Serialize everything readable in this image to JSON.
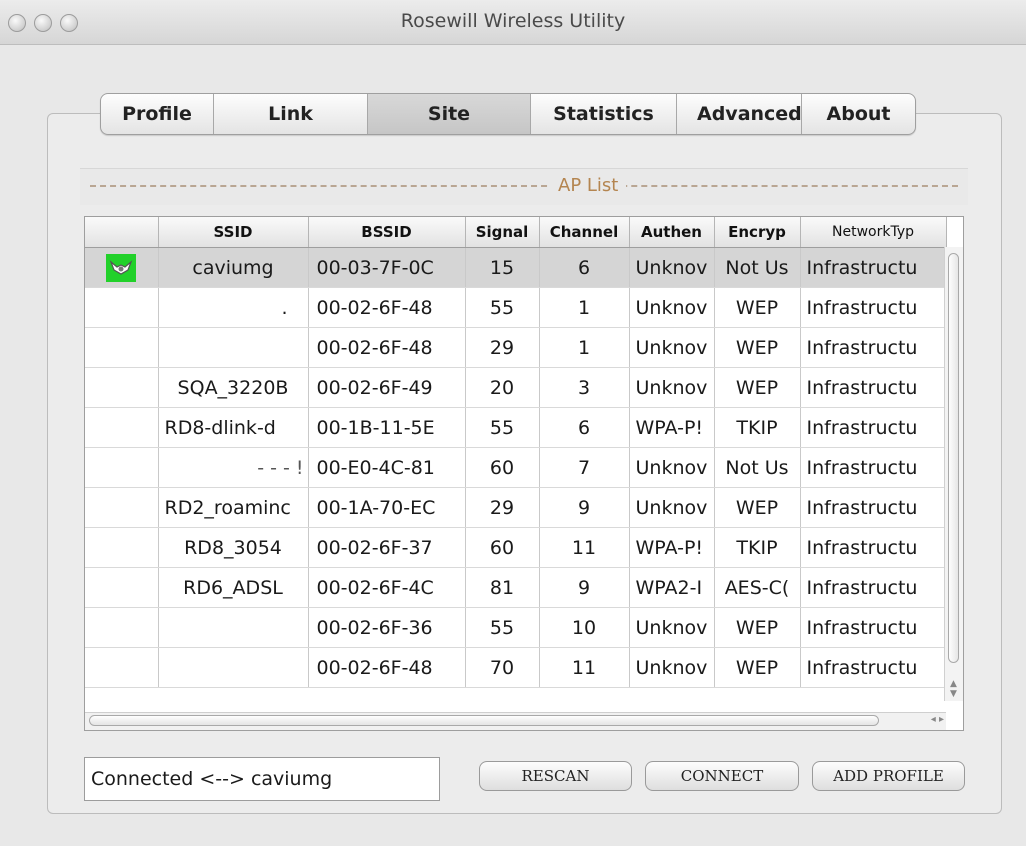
{
  "window": {
    "title": "Rosewill Wireless Utility"
  },
  "tabs": [
    {
      "label": "Profile"
    },
    {
      "label": "Link Status"
    },
    {
      "label": "Site Survey"
    },
    {
      "label": "Statistics"
    },
    {
      "label": "Advanced"
    },
    {
      "label": "About"
    }
  ],
  "active_tab": "Site Survey",
  "ap_list": {
    "label": "AP List",
    "columns": [
      "",
      "SSID",
      "BSSID",
      "Signal",
      "Channel",
      "Authen",
      "Encryp",
      "NetworkTyp"
    ],
    "rows": [
      {
        "selected": true,
        "icon": "connected-icon",
        "ssid": "caviumg",
        "bssid": "00-03-7F-0C",
        "signal": "15",
        "channel": "6",
        "authen": "Unknov",
        "encryp": "Not Us",
        "nettype": "Infrastructu"
      },
      {
        "ssid": ".",
        "bssid": "00-02-6F-48",
        "signal": "55",
        "channel": "1",
        "authen": "Unknov",
        "encryp": "WEP",
        "nettype": "Infrastructu"
      },
      {
        "ssid": "",
        "bssid": "00-02-6F-48",
        "signal": "29",
        "channel": "1",
        "authen": "Unknov",
        "encryp": "WEP",
        "nettype": "Infrastructu"
      },
      {
        "ssid": "SQA_3220B",
        "bssid": "00-02-6F-49",
        "signal": "20",
        "channel": "3",
        "authen": "Unknov",
        "encryp": "WEP",
        "nettype": "Infrastructu"
      },
      {
        "ssid": "RD8-dlink-d",
        "bssid": "00-1B-11-5E",
        "signal": "55",
        "channel": "6",
        "authen": "WPA-P!",
        "encryp": "TKIP",
        "nettype": "Infrastructu"
      },
      {
        "ssid": "-  -  -  !",
        "bssid": "00-E0-4C-81",
        "signal": "60",
        "channel": "7",
        "authen": "Unknov",
        "encryp": "Not Us",
        "nettype": "Infrastructu"
      },
      {
        "ssid": "RD2_roaminc",
        "bssid": "00-1A-70-EC",
        "signal": "29",
        "channel": "9",
        "authen": "Unknov",
        "encryp": "WEP",
        "nettype": "Infrastructu"
      },
      {
        "ssid": "RD8_3054",
        "bssid": "00-02-6F-37",
        "signal": "60",
        "channel": "11",
        "authen": "WPA-P!",
        "encryp": "TKIP",
        "nettype": "Infrastructu"
      },
      {
        "ssid": "RD6_ADSL",
        "bssid": "00-02-6F-4C",
        "signal": "81",
        "channel": "9",
        "authen": "WPA2-I",
        "encryp": "AES-C(",
        "nettype": "Infrastructu"
      },
      {
        "ssid": "",
        "bssid": "00-02-6F-36",
        "signal": "55",
        "channel": "10",
        "authen": "Unknov",
        "encryp": "WEP",
        "nettype": "Infrastructu"
      },
      {
        "ssid": "",
        "bssid": "00-02-6F-48",
        "signal": "70",
        "channel": "11",
        "authen": "Unknov",
        "encryp": "WEP",
        "nettype": "Infrastructu"
      }
    ]
  },
  "status": {
    "text": "Connected <--> caviumg"
  },
  "buttons": {
    "rescan": "RESCAN",
    "connect": "CONNECT",
    "add_profile": "ADD PROFILE"
  },
  "colors": {
    "selected_row": "#d5d5d5",
    "icon_bg": "#22d12a",
    "ap_label": "#b48550"
  }
}
